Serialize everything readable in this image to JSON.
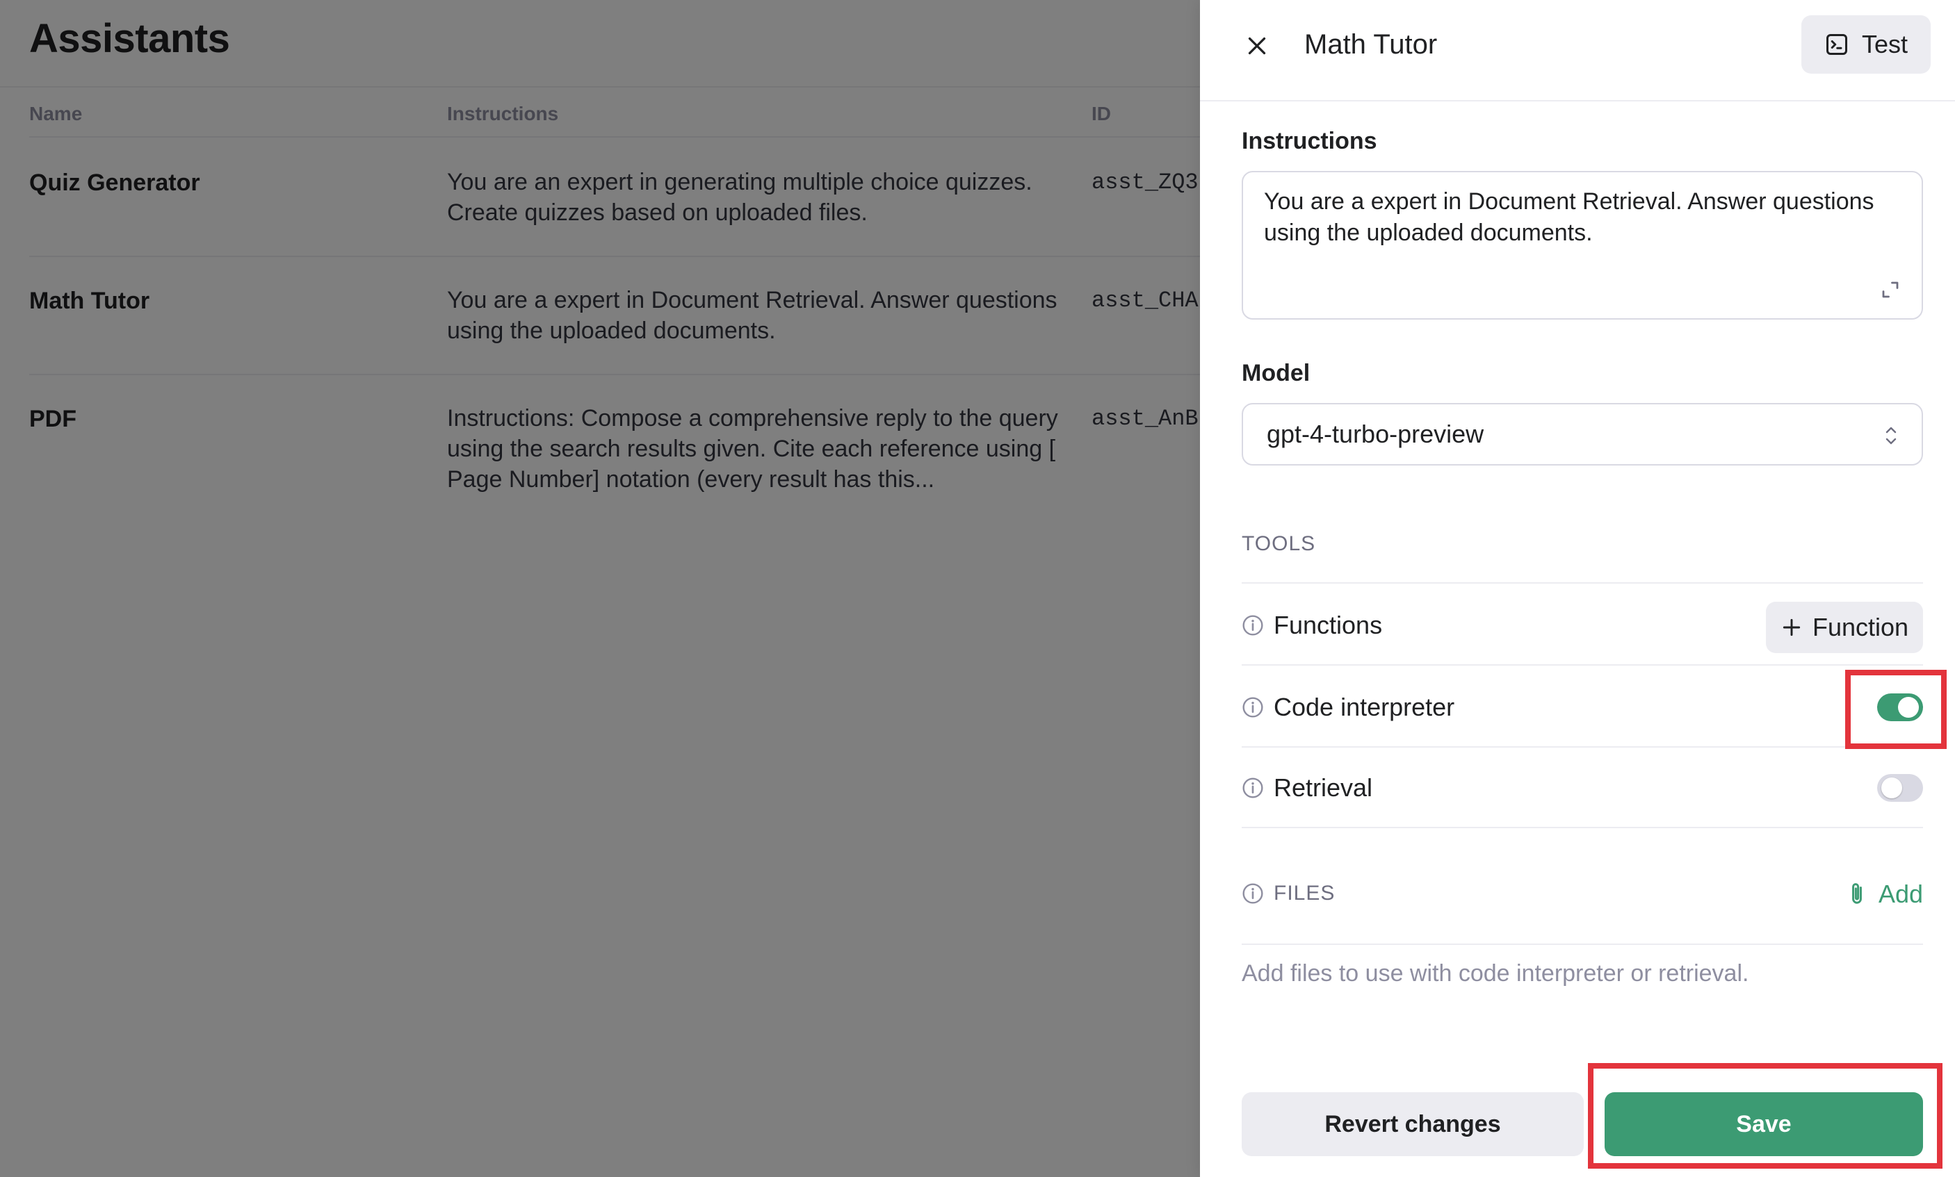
{
  "page": {
    "title": "Assistants",
    "columns": {
      "name": "Name",
      "instructions": "Instructions",
      "id": "ID"
    },
    "rows": [
      {
        "name": "Quiz Generator",
        "instructions": "You are an expert in generating multiple choice quizzes. Create quizzes based on uploaded files.",
        "id": "asst_ZQ3"
      },
      {
        "name": "Math Tutor",
        "instructions": "You are a expert in Document Retrieval. Answer questions using the uploaded documents.",
        "id": "asst_CHA"
      },
      {
        "name": "PDF",
        "instructions": "Instructions: Compose a comprehensive reply to the query using the search results given. Cite each reference using [ Page Number] notation (every result has this...",
        "id": "asst_AnB"
      }
    ]
  },
  "panel": {
    "title": "Math Tutor",
    "test_label": "Test",
    "instructions_label": "Instructions",
    "instructions_value": "You are a expert in Document Retrieval. Answer questions using the uploaded documents.",
    "model_label": "Model",
    "model_value": "gpt-4-turbo-preview",
    "tools_label": "TOOLS",
    "tools": {
      "functions": {
        "label": "Functions",
        "button": "Function"
      },
      "code_interpreter": {
        "label": "Code interpreter",
        "enabled": true
      },
      "retrieval": {
        "label": "Retrieval",
        "enabled": false
      }
    },
    "files_label": "FILES",
    "files_add": "Add",
    "files_hint": "Add files to use with code interpreter or retrieval.",
    "revert_label": "Revert changes",
    "save_label": "Save"
  },
  "colors": {
    "accent": "#3c9b73",
    "highlight": "#e3343c",
    "overlay": "#7a7a7a"
  },
  "icons": [
    "close-icon",
    "terminal-icon",
    "expand-icon",
    "chevron-updown-icon",
    "info-icon",
    "plus-icon",
    "paperclip-icon"
  ]
}
